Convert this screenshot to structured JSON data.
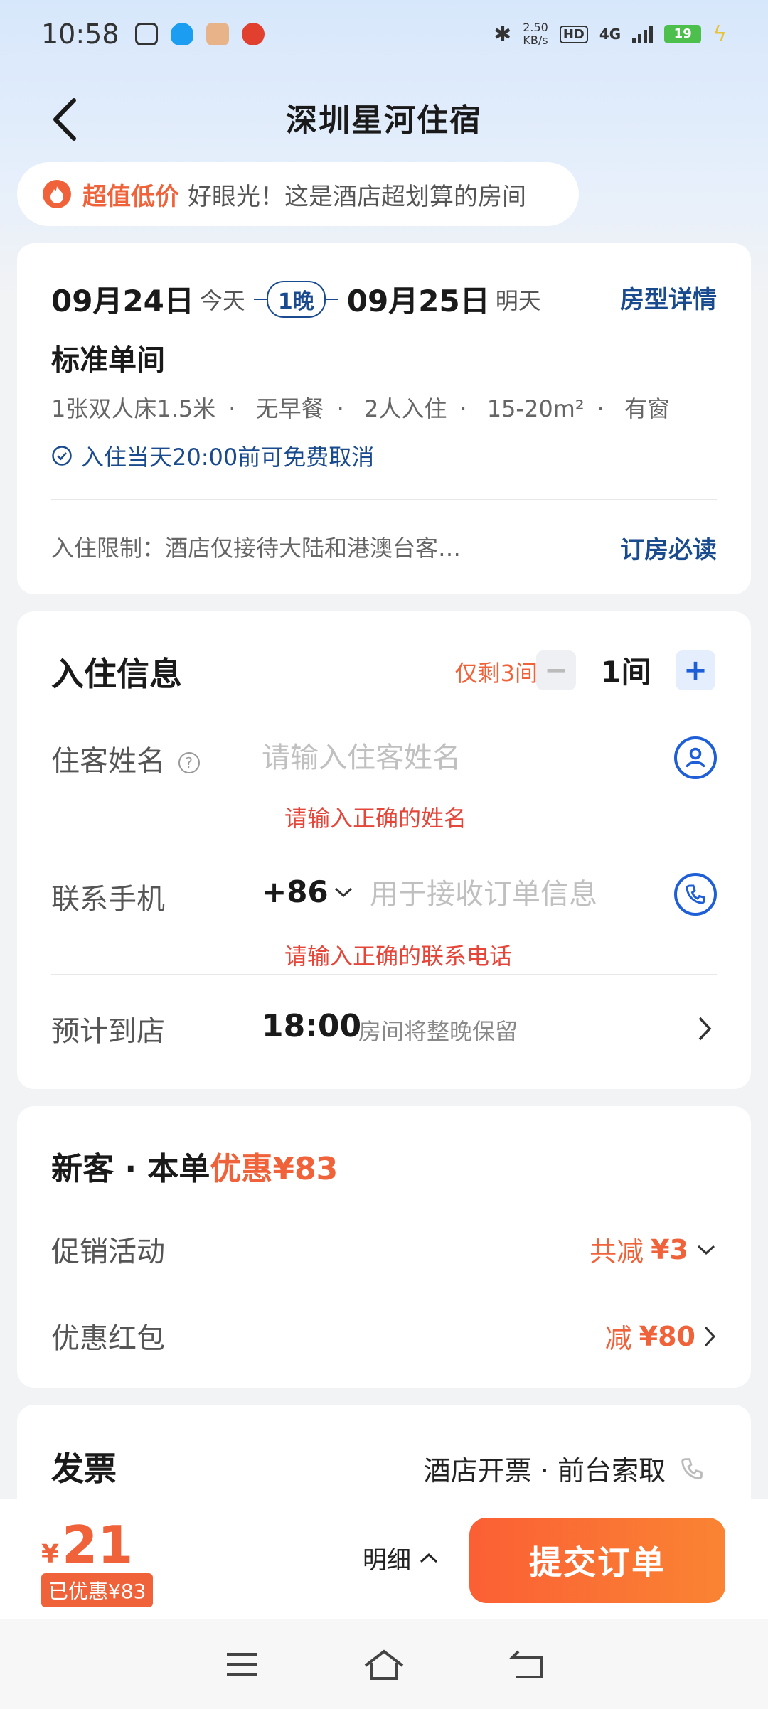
{
  "status_bar": {
    "time": "10:58",
    "net_speed_value": "2.50",
    "net_speed_unit": "KB/s",
    "hd_label": "HD",
    "network": "4G",
    "battery": "19"
  },
  "nav": {
    "title": "深圳星河住宿"
  },
  "promo_banner": {
    "tag": "超值低价",
    "text": "好眼光！这是酒店超划算的房间"
  },
  "stay": {
    "checkin_date": "09月24日",
    "checkin_day": "今天",
    "nights": "1晚",
    "checkout_date": "09月25日",
    "checkout_day": "明天",
    "room_detail_link": "房型详情",
    "room_name": "标准单间",
    "features": [
      "1张双人床1.5米",
      "无早餐",
      "2人入住",
      "15-20m²",
      "有窗"
    ],
    "cancel_policy": "入住当天20:00前可免费取消",
    "restriction": "入住限制：酒店仅接待大陆和港澳台客…",
    "must_read_link": "订房必读"
  },
  "guest_info": {
    "title": "入住信息",
    "rooms_left": "仅剩3间",
    "room_count": "1间",
    "minus": "−",
    "plus": "+",
    "name_label": "住客姓名",
    "name_placeholder": "请输入住客姓名",
    "name_error": "请输入正确的姓名",
    "phone_label": "联系手机",
    "country_code": "+86",
    "phone_placeholder": "用于接收订单信息",
    "phone_error": "请输入正确的联系电话",
    "arrival_label": "预计到店",
    "arrival_time": "18:00",
    "arrival_note": "房间将整晚保留"
  },
  "discounts": {
    "title_prefix": "新客 · 本单",
    "title_highlight": "优惠¥83",
    "promo_label": "促销活动",
    "promo_value_prefix": "共减",
    "promo_value": "¥3",
    "coupon_label": "优惠红包",
    "coupon_value_prefix": "减",
    "coupon_value": "¥80"
  },
  "invoice": {
    "title": "发票",
    "value": "酒店开票 · 前台索取"
  },
  "bottom_bar": {
    "currency": "¥",
    "price": "21",
    "saved": "已优惠¥83",
    "detail_label": "明细",
    "submit_label": "提交订单"
  },
  "colors": {
    "accent_orange": "#f0633a",
    "link_blue": "#1a4b8f",
    "icon_blue": "#1e5fd8",
    "error_red": "#e5463a"
  }
}
